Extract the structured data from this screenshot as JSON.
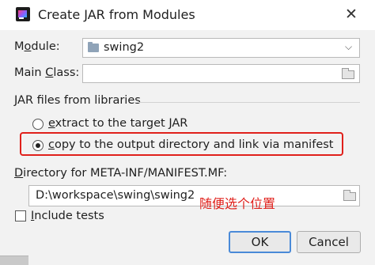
{
  "window": {
    "title": "Create JAR from Modules"
  },
  "module": {
    "label_pre": "M",
    "label_mn": "o",
    "label_post": "dule:",
    "value": "swing2"
  },
  "main_class": {
    "label_pre": "Main ",
    "label_mn": "C",
    "label_post": "lass:",
    "value": ""
  },
  "libraries": {
    "section_label": "JAR files from libraries",
    "options": [
      {
        "label_mn": "e",
        "label_rest": "xtract to the target JAR",
        "selected": false
      },
      {
        "label_mn": "c",
        "label_rest": "opy to the output directory and link via manifest",
        "selected": true
      }
    ]
  },
  "manifest": {
    "label_mn": "D",
    "label_post": "irectory for META-INF/MANIFEST.MF:",
    "value": "D:\\workspace\\swing\\swing2"
  },
  "annotation": "随便选个位置",
  "include_tests": {
    "label_mn": "I",
    "label_post": "nclude tests",
    "checked": false
  },
  "buttons": {
    "ok": "OK",
    "cancel": "Cancel"
  },
  "colors": {
    "highlight": "#e0201b",
    "default_button_border": "#4a8ad8"
  },
  "icons": [
    "app-icon",
    "close-icon",
    "module-icon",
    "chevron-down-icon",
    "folder-icon"
  ]
}
